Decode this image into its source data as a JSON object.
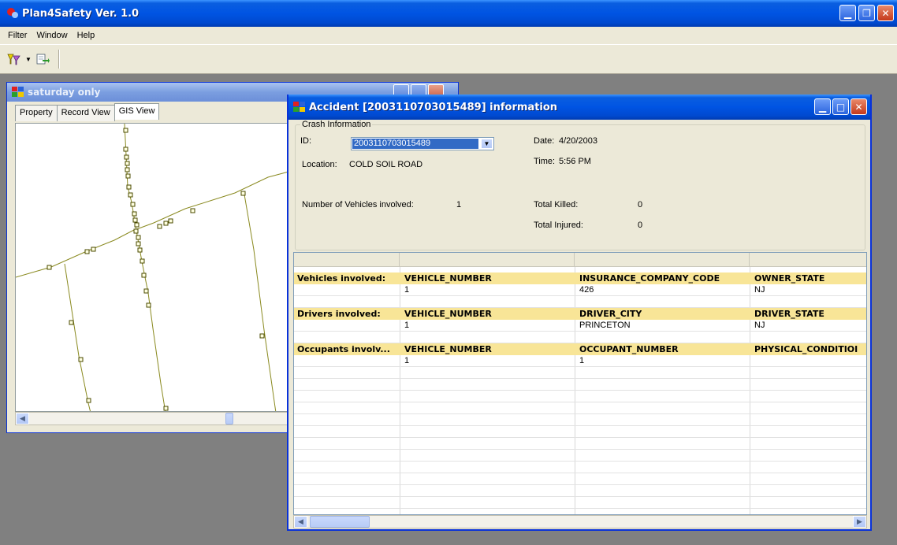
{
  "app": {
    "title": "Plan4Safety Ver. 1.0",
    "menu": [
      "Filter",
      "Window",
      "Help"
    ]
  },
  "map_window": {
    "title": "saturday only",
    "tabs": [
      {
        "label": "Property",
        "active": false
      },
      {
        "label": "Record View",
        "active": false
      },
      {
        "label": "GIS View",
        "active": true
      }
    ]
  },
  "accident_window": {
    "title": "Accident [2003110703015489] information",
    "crash": {
      "group_label": "Crash Information",
      "id_label": "ID:",
      "id_value": "2003110703015489",
      "location_label": "Location:",
      "location_value": "COLD SOIL ROAD",
      "vehicles_label": "Number of Vehicles involved:",
      "vehicles_value": "1",
      "date_label": "Date:",
      "date_value": "4/20/2003",
      "time_label": "Time:",
      "time_value": "5:56 PM",
      "killed_label": "Total Killed:",
      "killed_value": "0",
      "injured_label": "Total Injured:",
      "injured_value": "0"
    },
    "sections": [
      {
        "label": "Vehicles involved:",
        "headers": [
          "VEHICLE_NUMBER",
          "INSURANCE_COMPANY_CODE",
          "OWNER_STATE"
        ],
        "values": [
          "1",
          "426",
          "NJ"
        ]
      },
      {
        "label": "Drivers involved:",
        "headers": [
          "VEHICLE_NUMBER",
          "DRIVER_CITY",
          "DRIVER_STATE"
        ],
        "values": [
          "1",
          "PRINCETON",
          "NJ"
        ]
      },
      {
        "label": "Occupants involv...",
        "headers": [
          "VEHICLE_NUMBER",
          "OCCUPANT_NUMBER",
          "PHYSICAL_CONDITIOI"
        ],
        "values": [
          "1",
          "1",
          ""
        ]
      }
    ]
  },
  "colors": {
    "titlebar": "#0054e3",
    "highlight_row": "#f8e597",
    "selection": "#316ac5",
    "map_line": "#8a8a20"
  }
}
